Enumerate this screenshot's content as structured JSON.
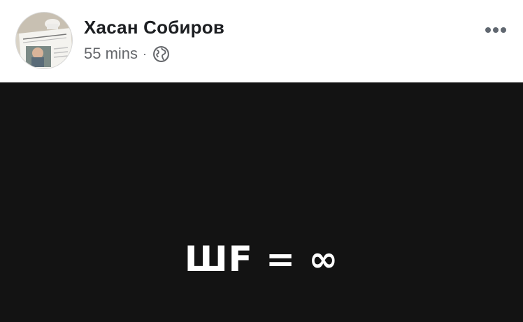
{
  "post": {
    "author_name": "Хасан Собиров",
    "timestamp": "55 mins",
    "separator": "·",
    "privacy_icon": "globe-icon",
    "more_icon": "more-dots-icon",
    "avatar_icon": "profile-photo"
  },
  "media": {
    "text": "ШF = ∞",
    "background_color": "#131313",
    "text_color": "#ffffff"
  }
}
